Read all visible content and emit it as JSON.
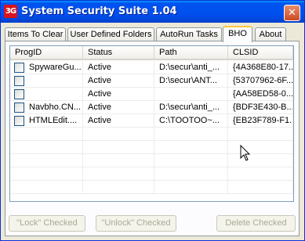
{
  "window": {
    "title": "System Security Suite 1.04",
    "icon_text": "3G",
    "close_glyph": "✕"
  },
  "tabs": [
    {
      "label": "Items To Clear",
      "active": false
    },
    {
      "label": "User Defined Folders",
      "active": false
    },
    {
      "label": "AutoRun Tasks",
      "active": false
    },
    {
      "label": "BHO",
      "active": true
    },
    {
      "label": "About",
      "active": false
    }
  ],
  "table": {
    "columns": [
      "ProgID",
      "Status",
      "Path",
      "CLSID"
    ],
    "rows": [
      {
        "progid": "SpywareGu...",
        "status": "Active",
        "path": "D:\\secur\\anti_...",
        "clsid": "{4A368E80-17...",
        "checked": false
      },
      {
        "progid": "",
        "status": "Active",
        "path": "D:\\secur\\ANT...",
        "clsid": "{53707962-6F...",
        "checked": false
      },
      {
        "progid": "",
        "status": "Active",
        "path": "",
        "clsid": "{AA58ED58-0...",
        "checked": false
      },
      {
        "progid": "Navbho.CN...",
        "status": "Active",
        "path": "D:\\secur\\anti_...",
        "clsid": "{BDF3E430-B...",
        "checked": false
      },
      {
        "progid": "HTMLEdit....",
        "status": "Active",
        "path": "C:\\TOOTOO~...",
        "clsid": "{EB23F789-F1...",
        "checked": false
      }
    ]
  },
  "buttons": {
    "lock": "\"Lock\" Checked",
    "unlock": "\"Unlock\" Checked",
    "delete": "Delete Checked"
  }
}
